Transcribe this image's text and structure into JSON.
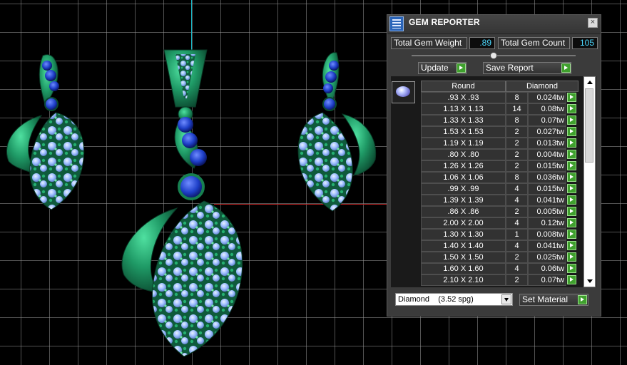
{
  "panel": {
    "title": "GEM REPORTER",
    "close_glyph": "×",
    "icons": {
      "app": "gem-reporter-icon",
      "close": "close-icon",
      "gem": "round-diamond-icon"
    },
    "total_weight_label": "Total Gem Weight",
    "total_weight_value": ".89",
    "total_count_label": "Total Gem Count",
    "total_count_value": "105",
    "update_label": "Update",
    "save_report_label": "Save Report",
    "table": {
      "col_shape": "Round",
      "col_material": "Diamond",
      "rows": [
        {
          "size": ".93 X .93",
          "count": "8",
          "tw": "0.024tw"
        },
        {
          "size": "1.13 X 1.13",
          "count": "14",
          "tw": "0.08tw"
        },
        {
          "size": "1.33 X 1.33",
          "count": "8",
          "tw": "0.07tw"
        },
        {
          "size": "1.53 X 1.53",
          "count": "2",
          "tw": "0.027tw"
        },
        {
          "size": "1.19 X 1.19",
          "count": "2",
          "tw": "0.013tw"
        },
        {
          "size": ".80 X .80",
          "count": "2",
          "tw": "0.004tw"
        },
        {
          "size": "1.26 X 1.26",
          "count": "2",
          "tw": "0.015tw"
        },
        {
          "size": "1.06 X 1.06",
          "count": "8",
          "tw": "0.036tw"
        },
        {
          "size": ".99 X .99",
          "count": "4",
          "tw": "0.015tw"
        },
        {
          "size": "1.39 X 1.39",
          "count": "4",
          "tw": "0.041tw"
        },
        {
          "size": ".86 X .86",
          "count": "2",
          "tw": "0.005tw"
        },
        {
          "size": "2.00 X 2.00",
          "count": "4",
          "tw": "0.12tw"
        },
        {
          "size": "1.30 X 1.30",
          "count": "1",
          "tw": "0.008tw"
        },
        {
          "size": "1.40 X 1.40",
          "count": "4",
          "tw": "0.041tw"
        },
        {
          "size": "1.50 X 1.50",
          "count": "2",
          "tw": "0.025tw"
        },
        {
          "size": "1.60 X 1.60",
          "count": "4",
          "tw": "0.06tw"
        },
        {
          "size": "2.10 X 2.10",
          "count": "2",
          "tw": "0.07tw"
        }
      ]
    },
    "material_select": "Diamond    (3.52 spg)",
    "set_material_label": "Set Material"
  },
  "colors": {
    "metal": "#1f9a66",
    "sapphire": "#1e3fc8",
    "diamond": "#9fc0ff",
    "value_text": "#4cd9ff",
    "action_green": "#3fa02d"
  }
}
